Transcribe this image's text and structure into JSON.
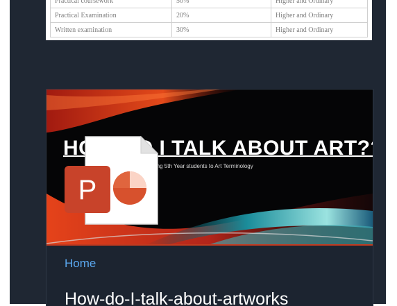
{
  "assessment_table": {
    "rows": [
      {
        "component": "Practical coursework",
        "weighting": "50%",
        "levels": "Higher and Ordinary"
      },
      {
        "component": "Practical Examination",
        "weighting": "20%",
        "levels": "Higher and Ordinary"
      },
      {
        "component": "Written examination",
        "weighting": "30%",
        "levels": "Higher and Ordinary"
      }
    ]
  },
  "slide": {
    "title": "HOW DO I TALK ABOUT ART??",
    "subtitle": "Introducing 5th Year students to Art Terminology",
    "file_type_icon": "powerpoint-file-icon",
    "icon_letter": "P"
  },
  "card": {
    "home_label": "Home",
    "title": "How-do-I-talk-about-artworks"
  },
  "colors": {
    "page_background": "#1f2733",
    "link": "#5aa7ee",
    "powerpoint_orange": "#c8432a"
  }
}
